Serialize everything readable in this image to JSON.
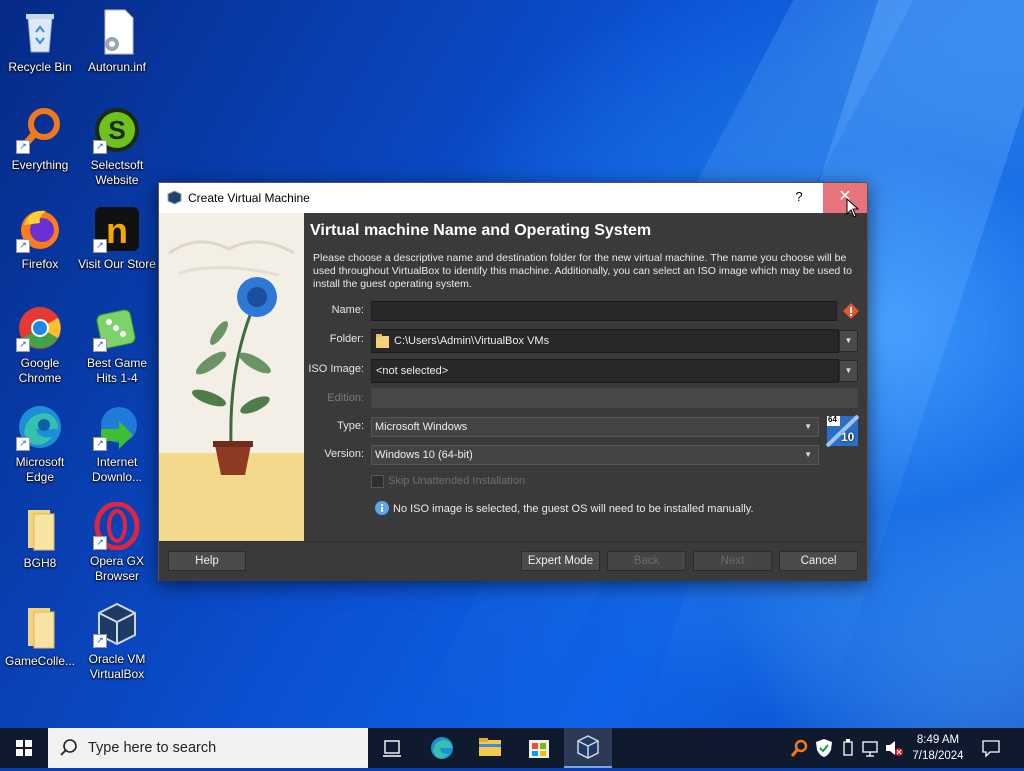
{
  "desktop": {
    "icons": [
      {
        "label": "Recycle Bin"
      },
      {
        "label": "Autorun.inf"
      },
      {
        "label": "Everything"
      },
      {
        "label": "Selectsoft Website"
      },
      {
        "label": "Firefox"
      },
      {
        "label": "Visit Our Store"
      },
      {
        "label": "Google Chrome"
      },
      {
        "label": "Best Game Hits 1-4"
      },
      {
        "label": "Microsoft Edge"
      },
      {
        "label": "Internet Downlo..."
      },
      {
        "label": "BGH8"
      },
      {
        "label": "Opera GX Browser"
      },
      {
        "label": "GameColle..."
      },
      {
        "label": "Oracle VM VirtualBox"
      }
    ]
  },
  "dialog": {
    "title": "Create Virtual Machine",
    "help_glyph": "?",
    "close_glyph": "✕",
    "heading": "Virtual machine Name and Operating System",
    "description": "Please choose a descriptive name and destination folder for the new virtual machine. The name you choose will be used throughout VirtualBox to identify this machine. Additionally, you can select an ISO image which may be used to install the guest operating system.",
    "fields": {
      "name_label": "Name:",
      "name_value": "",
      "folder_label": "Folder:",
      "folder_value": "C:\\Users\\Admin\\VirtualBox VMs",
      "iso_label": "ISO Image:",
      "iso_value": "<not selected>",
      "edition_label": "Edition:",
      "edition_value": "",
      "type_label": "Type:",
      "type_value": "Microsoft Windows",
      "version_label": "Version:",
      "version_value": "Windows 10 (64-bit)",
      "os_badge_top": "64",
      "os_badge_bottom": "10"
    },
    "skip_unattended_label": "Skip Unattended Installation",
    "skip_unattended_checked": false,
    "info_message": "No ISO image is selected, the guest OS will need to be installed manually.",
    "buttons": {
      "help": "Help",
      "expert_mode": "Expert Mode",
      "back": "Back",
      "next": "Next",
      "cancel": "Cancel"
    }
  },
  "taskbar": {
    "search_placeholder": "Type here to search",
    "time": "8:49 AM",
    "date": "7/18/2024"
  }
}
